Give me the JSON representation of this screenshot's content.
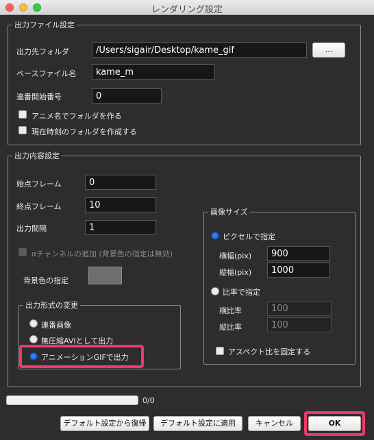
{
  "window": {
    "title": "レンダリング設定"
  },
  "output_file": {
    "legend": "出力ファイル設定",
    "folder_label": "出力先フォルダ",
    "folder_value": "/Users/sigair/Desktop/kame_gif",
    "browse_label": "...",
    "basename_label": "ベースファイル名",
    "basename_value": "kame_m",
    "start_number_label": "連番開始番号",
    "start_number_value": "0",
    "option_anime_folder": "アニメ名でフォルダを作る",
    "option_time_folder": "現在時刻のフォルダを作成する"
  },
  "output_content": {
    "legend": "出力内容設定",
    "start_frame_label": "始点フレーム",
    "start_frame_value": "0",
    "end_frame_label": "終点フレーム",
    "end_frame_value": "10",
    "interval_label": "出力間隔",
    "interval_value": "1",
    "alpha_label": "αチャンネルの追加 (背景色の指定は無効)",
    "bg_color_label": "背景色の指定",
    "bg_color": "#6e6e6e"
  },
  "format": {
    "legend": "出力形式の変更",
    "options": [
      "連番画像",
      "無圧縮AVIとして出力",
      "アニメーションGIFで出力"
    ],
    "selected": "アニメーションGIFで出力"
  },
  "image_size": {
    "legend": "画像サイズ",
    "pixel_option": "ピクセルで指定",
    "width_label": "横幅(pix)",
    "width_value": "900",
    "height_label": "縦幅(pix)",
    "height_value": "1000",
    "ratio_option": "比率で指定",
    "hratio_label": "横比率",
    "hratio_value": "100",
    "vratio_label": "縦比率",
    "vratio_value": "100",
    "aspect_label": "アスペクト比を固定する"
  },
  "progress": {
    "text": "0/0",
    "fraction": 0
  },
  "buttons": {
    "restore": "デフォルト設定から復帰",
    "apply": "デフォルト設定に適用",
    "cancel": "キャンセル",
    "ok": "OK"
  },
  "colors": {
    "highlight": "#f0386a",
    "radio_selected": "#1e5fd0"
  }
}
